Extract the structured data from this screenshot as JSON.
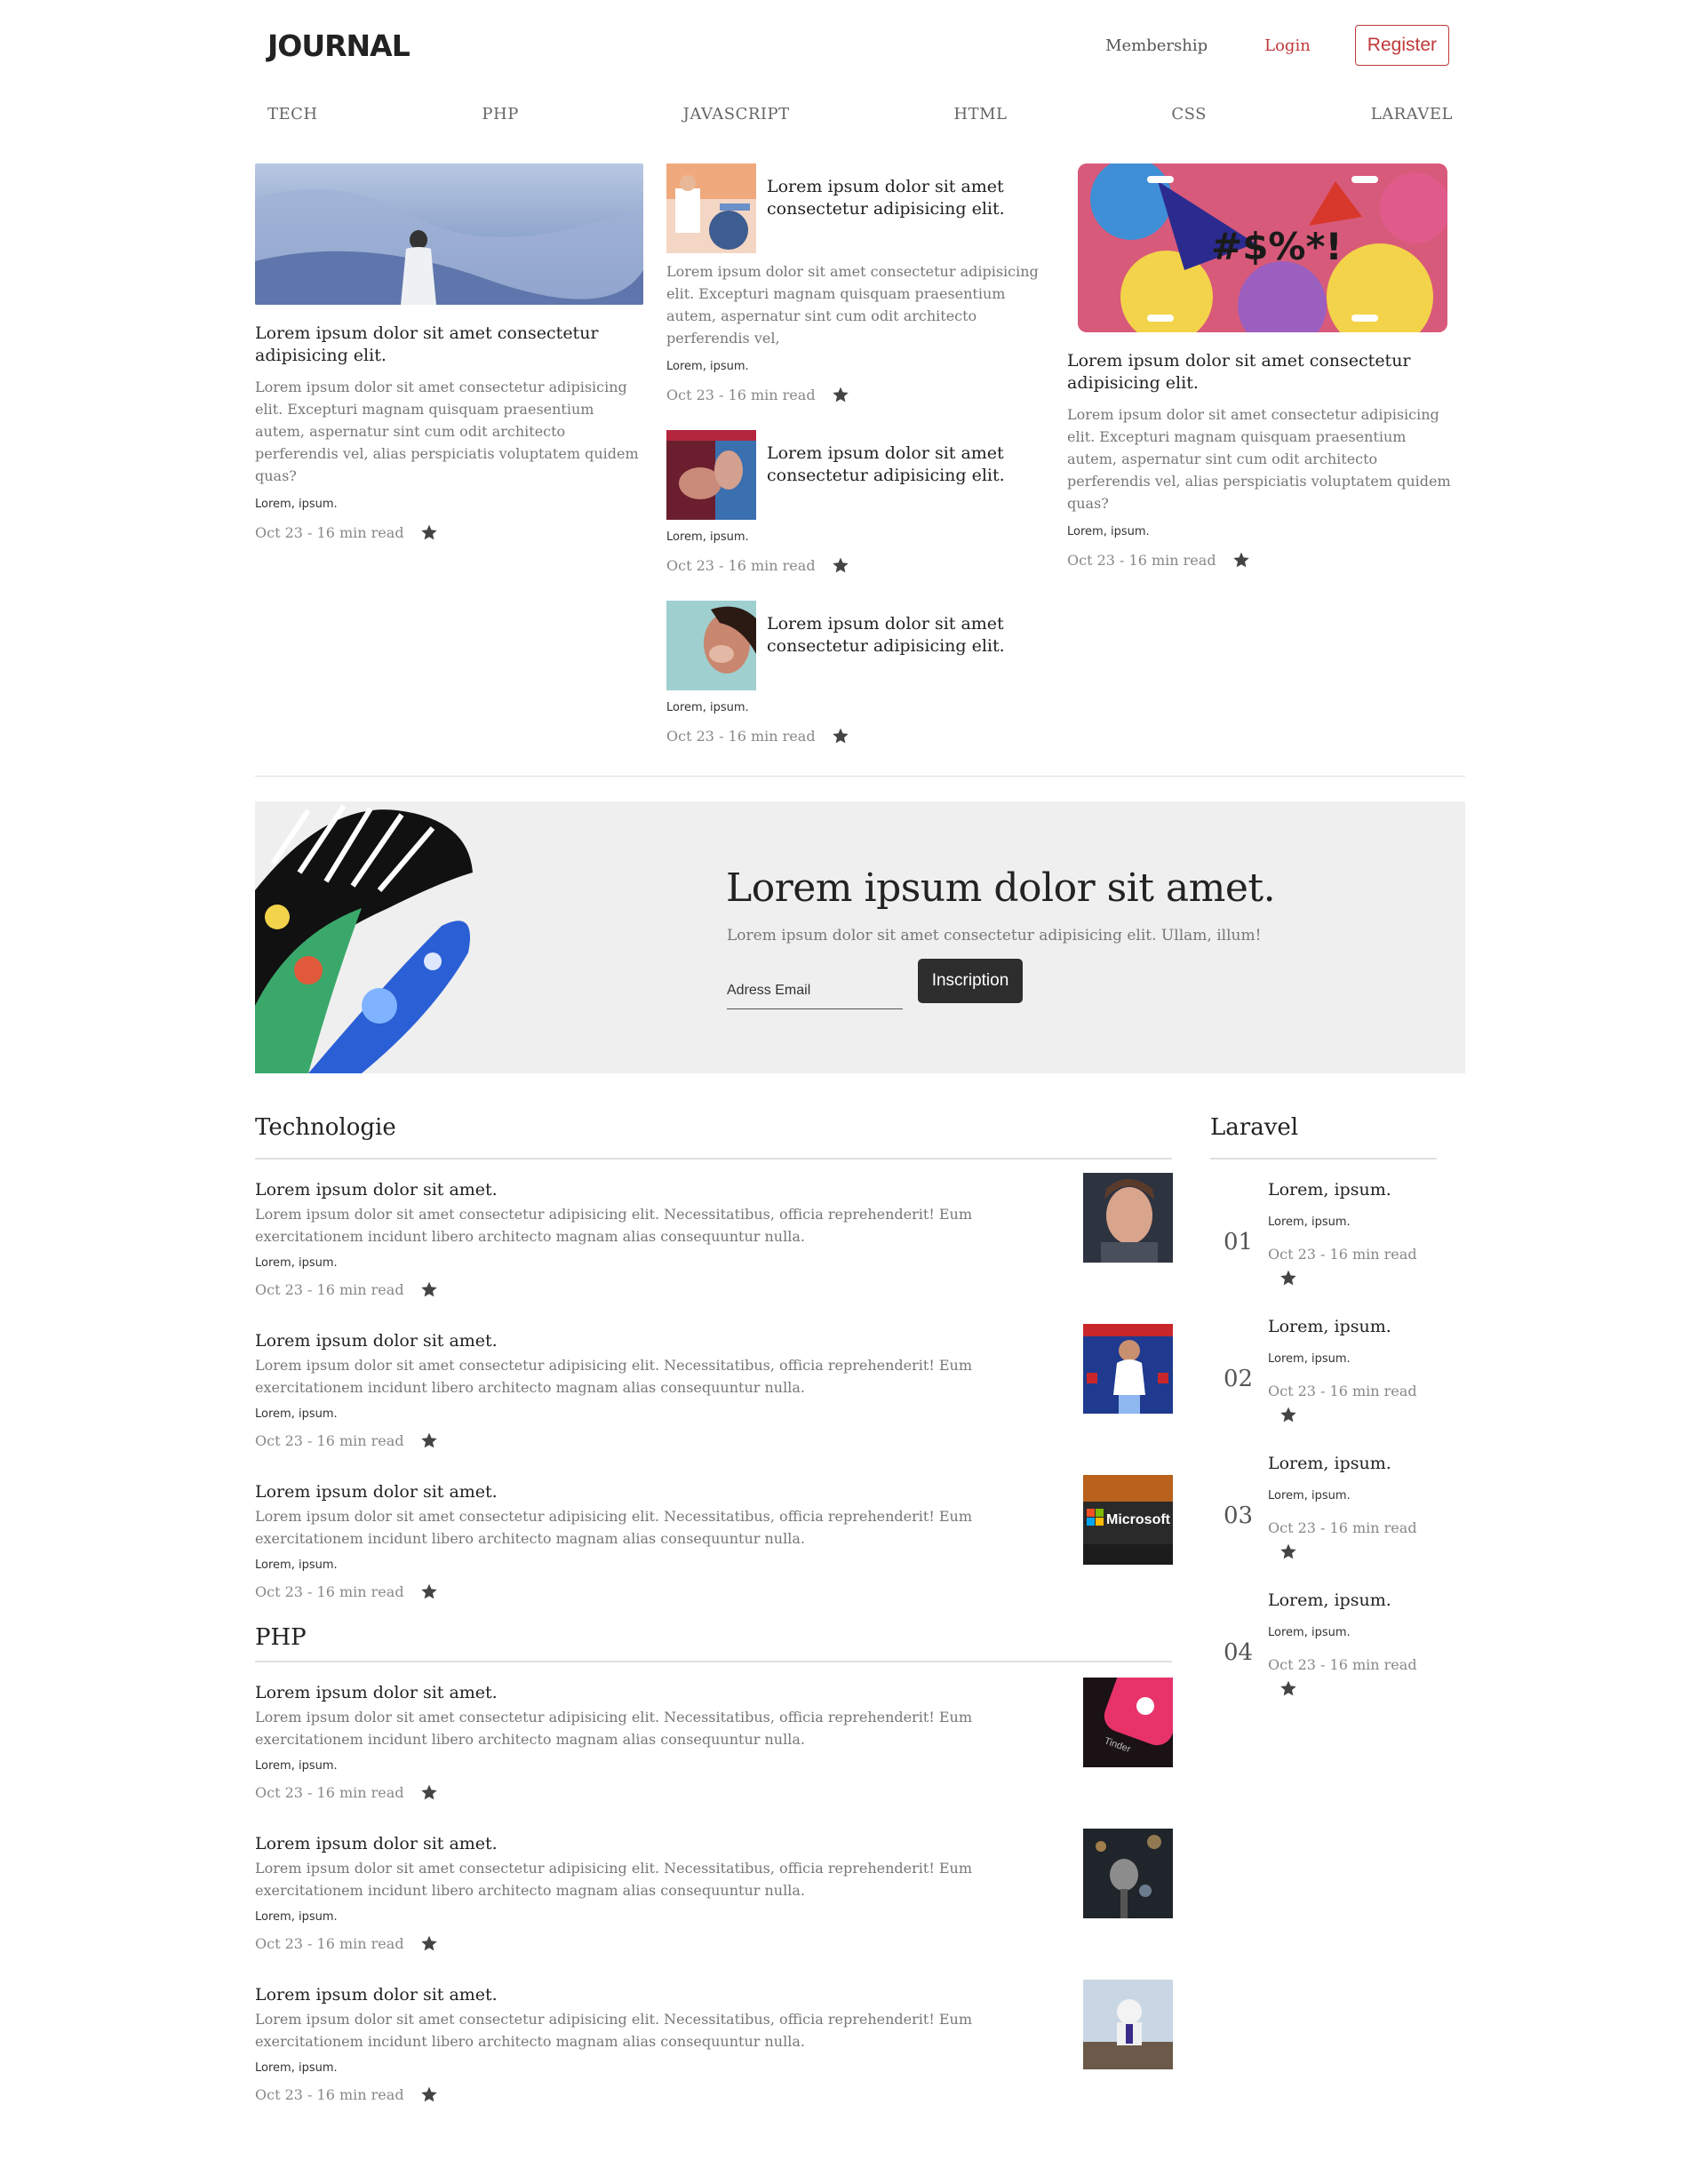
{
  "brand": "JOURNAL",
  "topnav": {
    "membership": "Membership",
    "login": "Login",
    "register": "Register"
  },
  "categories": [
    "TECH",
    "PHP",
    "JAVASCRIPT",
    "HTML",
    "CSS",
    "LARAVEL"
  ],
  "featured": {
    "left": {
      "title": "Lorem ipsum dolor sit amet consectetur adipisicing elit.",
      "excerpt": "Lorem ipsum dolor sit amet consectetur adipisicing elit. Excepturi magnam quisquam praesentium autem, aspernatur sint cum odit architecto perferendis vel, alias perspiciatis voluptatem quidem quas?",
      "author": "Lorem, ipsum.",
      "meta": "Oct 23 - 16 min read"
    },
    "middle": [
      {
        "title": "Lorem ipsum dolor sit amet consectetur adipisicing elit.",
        "excerpt": "Lorem ipsum dolor sit amet consectetur adipisicing elit. Excepturi magnam quisquam praesentium autem, aspernatur sint cum odit architecto perferendis vel,",
        "author": "Lorem, ipsum.",
        "meta": "Oct 23 - 16 min read"
      },
      {
        "title": "Lorem ipsum dolor sit amet consectetur adipisicing elit.",
        "author": "Lorem, ipsum.",
        "meta": "Oct 23 - 16 min read"
      },
      {
        "title": "Lorem ipsum dolor sit amet consectetur adipisicing elit.",
        "author": "Lorem, ipsum.",
        "meta": "Oct 23 - 16 min read"
      }
    ],
    "right": {
      "image_text": "#$%*!",
      "title": "Lorem ipsum dolor sit amet consectetur adipisicing elit.",
      "excerpt": "Lorem ipsum dolor sit amet consectetur adipisicing elit. Excepturi magnam quisquam praesentium autem, aspernatur sint cum odit architecto perferendis vel, alias perspiciatis voluptatem quidem quas?",
      "author": "Lorem, ipsum.",
      "meta": "Oct 23 - 16 min read"
    }
  },
  "newsletter": {
    "title": "Lorem ipsum dolor sit amet.",
    "subtitle": "Lorem ipsum dolor sit amet consectetur adipisicing elit. Ullam, illum!",
    "email_placeholder": "Adress Email",
    "button": "Inscription"
  },
  "technologie": {
    "title": "Technologie",
    "articles": [
      {
        "title": "Lorem ipsum dolor sit amet.",
        "body": "Lorem ipsum dolor sit amet consectetur adipisicing elit. Necessitatibus, officia reprehenderit! Eum exercitationem incidunt libero architecto magnam alias consequuntur nulla.",
        "author": "Lorem, ipsum.",
        "meta": "Oct 23 - 16 min read"
      },
      {
        "title": "Lorem ipsum dolor sit amet.",
        "body": "Lorem ipsum dolor sit amet consectetur adipisicing elit. Necessitatibus, officia reprehenderit! Eum exercitationem incidunt libero architecto magnam alias consequuntur nulla.",
        "author": "Lorem, ipsum.",
        "meta": "Oct 23 - 16 min read"
      },
      {
        "title": "Lorem ipsum dolor sit amet.",
        "body": "Lorem ipsum dolor sit amet consectetur adipisicing elit. Necessitatibus, officia reprehenderit! Eum exercitationem incidunt libero architecto magnam alias consequuntur nulla.",
        "author": "Lorem, ipsum.",
        "meta": "Oct 23 - 16 min read",
        "thumb_text": "Microsoft"
      }
    ]
  },
  "php": {
    "title": "PHP",
    "articles": [
      {
        "title": "Lorem ipsum dolor sit amet.",
        "body": "Lorem ipsum dolor sit amet consectetur adipisicing elit. Necessitatibus, officia reprehenderit! Eum exercitationem incidunt libero architecto magnam alias consequuntur nulla.",
        "author": "Lorem, ipsum.",
        "meta": "Oct 23 - 16 min read",
        "thumb_text": "Tinder"
      },
      {
        "title": "Lorem ipsum dolor sit amet.",
        "body": "Lorem ipsum dolor sit amet consectetur adipisicing elit. Necessitatibus, officia reprehenderit! Eum exercitationem incidunt libero architecto magnam alias consequuntur nulla.",
        "author": "Lorem, ipsum.",
        "meta": "Oct 23 - 16 min read"
      },
      {
        "title": "Lorem ipsum dolor sit amet.",
        "body": "Lorem ipsum dolor sit amet consectetur adipisicing elit. Necessitatibus, officia reprehenderit! Eum exercitationem incidunt libero architecto magnam alias consequuntur nulla.",
        "author": "Lorem, ipsum.",
        "meta": "Oct 23 - 16 min read"
      }
    ]
  },
  "laravel": {
    "title": "Laravel",
    "items": [
      {
        "num": "01",
        "title": "Lorem, ipsum.",
        "author": "Lorem, ipsum.",
        "meta": "Oct 23 - 16 min read"
      },
      {
        "num": "02",
        "title": "Lorem, ipsum.",
        "author": "Lorem, ipsum.",
        "meta": "Oct 23 - 16 min read"
      },
      {
        "num": "03",
        "title": "Lorem, ipsum.",
        "author": "Lorem, ipsum.",
        "meta": "Oct 23 - 16 min read"
      },
      {
        "num": "04",
        "title": "Lorem, ipsum.",
        "author": "Lorem, ipsum.",
        "meta": "Oct 23 - 16 min read"
      }
    ]
  },
  "icons": {
    "bookmark": "star-icon"
  },
  "colors": {
    "accent": "#c0393b",
    "button_dark": "#2d2d2d",
    "newsletter_bg": "#efefef"
  }
}
